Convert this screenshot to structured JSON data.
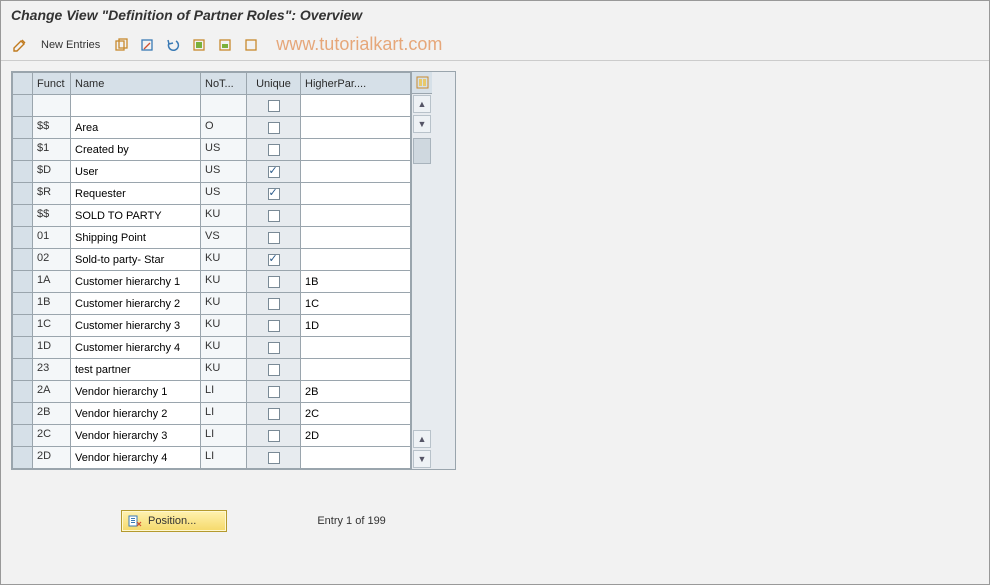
{
  "title": "Change View \"Definition of Partner Roles\": Overview",
  "toolbar": {
    "new_entries": "New Entries"
  },
  "watermark": "www.tutorialkart.com",
  "headers": {
    "funct": "Funct",
    "name": "Name",
    "not": "NoT...",
    "unique": "Unique",
    "higher": "HigherPar...."
  },
  "rows": [
    {
      "funct": "",
      "name": "",
      "not": "",
      "unique": false,
      "higher": ""
    },
    {
      "funct": "$$",
      "name": "Area",
      "not": "O",
      "unique": false,
      "higher": ""
    },
    {
      "funct": "$1",
      "name": "Created by",
      "not": "US",
      "unique": false,
      "higher": ""
    },
    {
      "funct": "$D",
      "name": "User",
      "not": "US",
      "unique": true,
      "higher": ""
    },
    {
      "funct": "$R",
      "name": "Requester",
      "not": "US",
      "unique": true,
      "higher": ""
    },
    {
      "funct": "$$",
      "name": "SOLD TO PARTY",
      "not": "KU",
      "unique": false,
      "higher": ""
    },
    {
      "funct": "01",
      "name": "Shipping Point",
      "not": "VS",
      "unique": false,
      "higher": ""
    },
    {
      "funct": "02",
      "name": "Sold-to party- Star",
      "not": "KU",
      "unique": true,
      "higher": ""
    },
    {
      "funct": "1A",
      "name": "Customer hierarchy 1",
      "not": "KU",
      "unique": false,
      "higher": "1B"
    },
    {
      "funct": "1B",
      "name": "Customer hierarchy 2",
      "not": "KU",
      "unique": false,
      "higher": "1C"
    },
    {
      "funct": "1C",
      "name": "Customer hierarchy 3",
      "not": "KU",
      "unique": false,
      "higher": "1D"
    },
    {
      "funct": "1D",
      "name": "Customer hierarchy 4",
      "not": "KU",
      "unique": false,
      "higher": ""
    },
    {
      "funct": "23",
      "name": "test partner",
      "not": "KU",
      "unique": false,
      "higher": ""
    },
    {
      "funct": "2A",
      "name": "Vendor hierarchy 1",
      "not": "LI",
      "unique": false,
      "higher": "2B"
    },
    {
      "funct": "2B",
      "name": "Vendor hierarchy 2",
      "not": "LI",
      "unique": false,
      "higher": "2C"
    },
    {
      "funct": "2C",
      "name": "Vendor hierarchy 3",
      "not": "LI",
      "unique": false,
      "higher": "2D"
    },
    {
      "funct": "2D",
      "name": "Vendor hierarchy 4",
      "not": "LI",
      "unique": false,
      "higher": ""
    }
  ],
  "position_btn": "Position...",
  "entry_status": "Entry 1 of 199"
}
